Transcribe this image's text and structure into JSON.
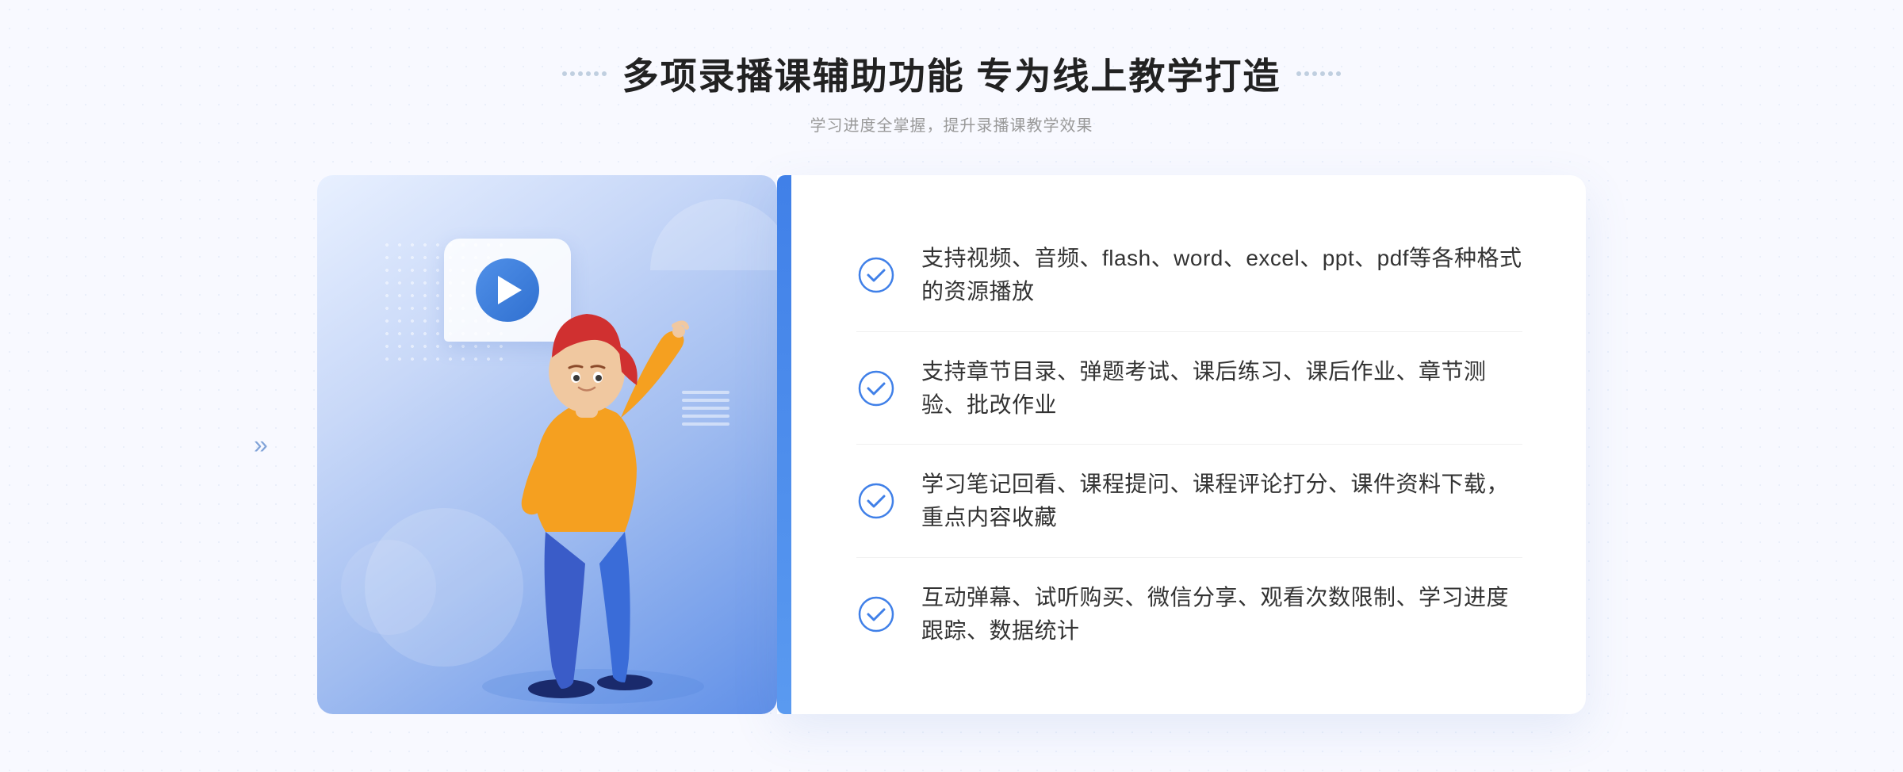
{
  "header": {
    "title": "多项录播课辅助功能 专为线上教学打造",
    "subtitle": "学习进度全掌握，提升录播课教学效果",
    "dots_left": [
      "",
      "",
      ""
    ],
    "dots_right": [
      "",
      "",
      ""
    ]
  },
  "features": [
    {
      "id": 1,
      "text": "支持视频、音频、flash、word、excel、ppt、pdf等各种格式的资源播放"
    },
    {
      "id": 2,
      "text": "支持章节目录、弹题考试、课后练习、课后作业、章节测验、批改作业"
    },
    {
      "id": 3,
      "text": "学习笔记回看、课程提问、课程评论打分、课件资料下载，重点内容收藏"
    },
    {
      "id": 4,
      "text": "互动弹幕、试听购买、微信分享、观看次数限制、学习进度跟踪、数据统计"
    }
  ],
  "colors": {
    "accent": "#4080e8",
    "title": "#222222",
    "subtitle": "#999999",
    "feature_text": "#333333",
    "check_color": "#4080e8"
  },
  "decoration": {
    "play_button_label": "play",
    "left_arrows": "«",
    "right_arrows": "»"
  }
}
